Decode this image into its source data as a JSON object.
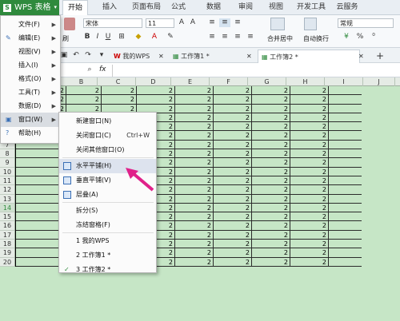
{
  "app": {
    "title": "WPS 表格"
  },
  "ribbon_tabs": [
    "开始",
    "插入",
    "页面布局",
    "公式",
    "数据",
    "审阅",
    "视图",
    "开发工具",
    "云服务"
  ],
  "ribbon": {
    "font_name": "宋体",
    "font_size": "11",
    "format_label": "刷",
    "merge_label": "合并居中",
    "wrap_label": "自动换行",
    "number_format": "常规",
    "percent": "%"
  },
  "doc_tabs": [
    "我的WPS",
    "工作簿1 *",
    "工作簿2 *"
  ],
  "formula_bar": {
    "fx": "fx"
  },
  "columns": [
    "B",
    "C",
    "D",
    "E",
    "F",
    "G",
    "H",
    "I",
    "J"
  ],
  "rows": [
    "",
    "",
    "",
    "",
    "",
    "",
    "7",
    "8",
    "9",
    "10",
    "11",
    "12",
    "13",
    "14",
    "15",
    "16",
    "17",
    "18",
    "19",
    "20"
  ],
  "cell_value": "2",
  "left_menu": {
    "items": [
      {
        "label": "文件(F)"
      },
      {
        "label": "编辑(E)"
      },
      {
        "label": "视图(V)"
      },
      {
        "label": "插入(I)"
      },
      {
        "label": "格式(O)"
      },
      {
        "label": "工具(T)"
      },
      {
        "label": "数据(D)"
      },
      {
        "label": "窗口(W)"
      },
      {
        "label": "帮助(H)"
      }
    ],
    "arrow": "▶"
  },
  "window_menu": {
    "items": [
      {
        "label": "新建窗口(N)",
        "shortcut": ""
      },
      {
        "label": "关闭窗口(C)",
        "shortcut": "Ctrl+W"
      },
      {
        "label": "关闭其他窗口(O)",
        "shortcut": ""
      },
      {
        "label": "水平平铺(H)",
        "shortcut": ""
      },
      {
        "label": "垂直平铺(V)",
        "shortcut": ""
      },
      {
        "label": "层叠(A)",
        "shortcut": ""
      },
      {
        "label": "拆分(S)",
        "shortcut": ""
      },
      {
        "label": "冻结窗格(F)",
        "shortcut": ""
      },
      {
        "label": "1 我的WPS",
        "shortcut": ""
      },
      {
        "label": "2 工作簿1 *",
        "shortcut": ""
      },
      {
        "label": "3 工作簿2 *",
        "shortcut": ""
      }
    ],
    "checkmark": "✓"
  },
  "colors": {
    "accent": "#2f8a3d",
    "sheet_bg": "#c6e6c6",
    "arrow": "#e0218a"
  }
}
